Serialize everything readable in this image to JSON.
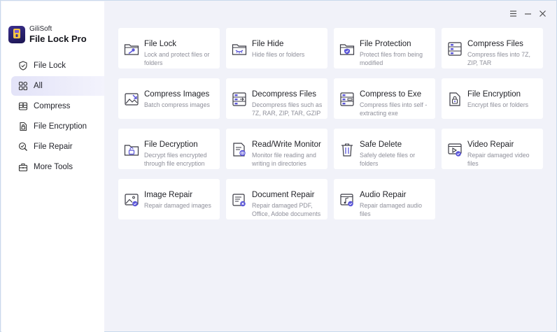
{
  "app": {
    "vendor": "GiliSoft",
    "name": "File Lock Pro",
    "accent": "#5b56d8"
  },
  "window_controls": [
    "menu-icon",
    "minimize-icon",
    "close-icon"
  ],
  "sidebar": {
    "items": [
      {
        "label": "File Lock",
        "icon": "shield-check-icon",
        "active": false
      },
      {
        "label": "All",
        "icon": "grid-icon",
        "active": true
      },
      {
        "label": "Compress",
        "icon": "compress-icon",
        "active": false
      },
      {
        "label": "File Encryption",
        "icon": "file-lock-icon",
        "active": false
      },
      {
        "label": "File Repair",
        "icon": "file-repair-icon",
        "active": false
      },
      {
        "label": "More Tools",
        "icon": "toolbox-icon",
        "active": false
      }
    ]
  },
  "tools": [
    {
      "title": "File Lock",
      "desc": "Lock and protect files or folders",
      "icon": "folder-key-icon"
    },
    {
      "title": "File Hide",
      "desc": "Hide files or folders",
      "icon": "folder-eye-icon"
    },
    {
      "title": "File Protection",
      "desc": "Protect files from being modified",
      "icon": "folder-shield-icon"
    },
    {
      "title": "Compress Files",
      "desc": "Compress files into 7Z, ZIP, TAR",
      "icon": "archive-icon"
    },
    {
      "title": "Compress Images",
      "desc": "Batch compress images",
      "icon": "image-compress-icon"
    },
    {
      "title": "Decompress Files",
      "desc": "Decompress files such as 7Z, RAR, ZIP, TAR, GZIP",
      "icon": "archive-open-icon"
    },
    {
      "title": "Compress to Exe",
      "desc": "Compress files into self - extracting exe",
      "icon": "archive-exe-icon"
    },
    {
      "title": "File Encryption",
      "desc": "Encrypt files or folders",
      "icon": "file-lock-icon"
    },
    {
      "title": "File Decryption",
      "desc": "Decrypt files encrypted through file encryption",
      "icon": "file-unlock-icon"
    },
    {
      "title": "Read/Write Monitor",
      "desc": "Monitor file reading and writing in directories",
      "icon": "monitor-eye-icon"
    },
    {
      "title": "Safe Delete",
      "desc": "Safely delete files or folders",
      "icon": "trash-icon"
    },
    {
      "title": "Video Repair",
      "desc": "Repair damaged video files",
      "icon": "video-repair-icon"
    },
    {
      "title": "Image Repair",
      "desc": "Repair damaged images",
      "icon": "image-repair-icon"
    },
    {
      "title": "Document Repair",
      "desc": "Repair damaged PDF, Office, Adobe documents",
      "icon": "document-repair-icon"
    },
    {
      "title": "Audio Repair",
      "desc": "Repair damaged audio files",
      "icon": "audio-repair-icon"
    }
  ]
}
